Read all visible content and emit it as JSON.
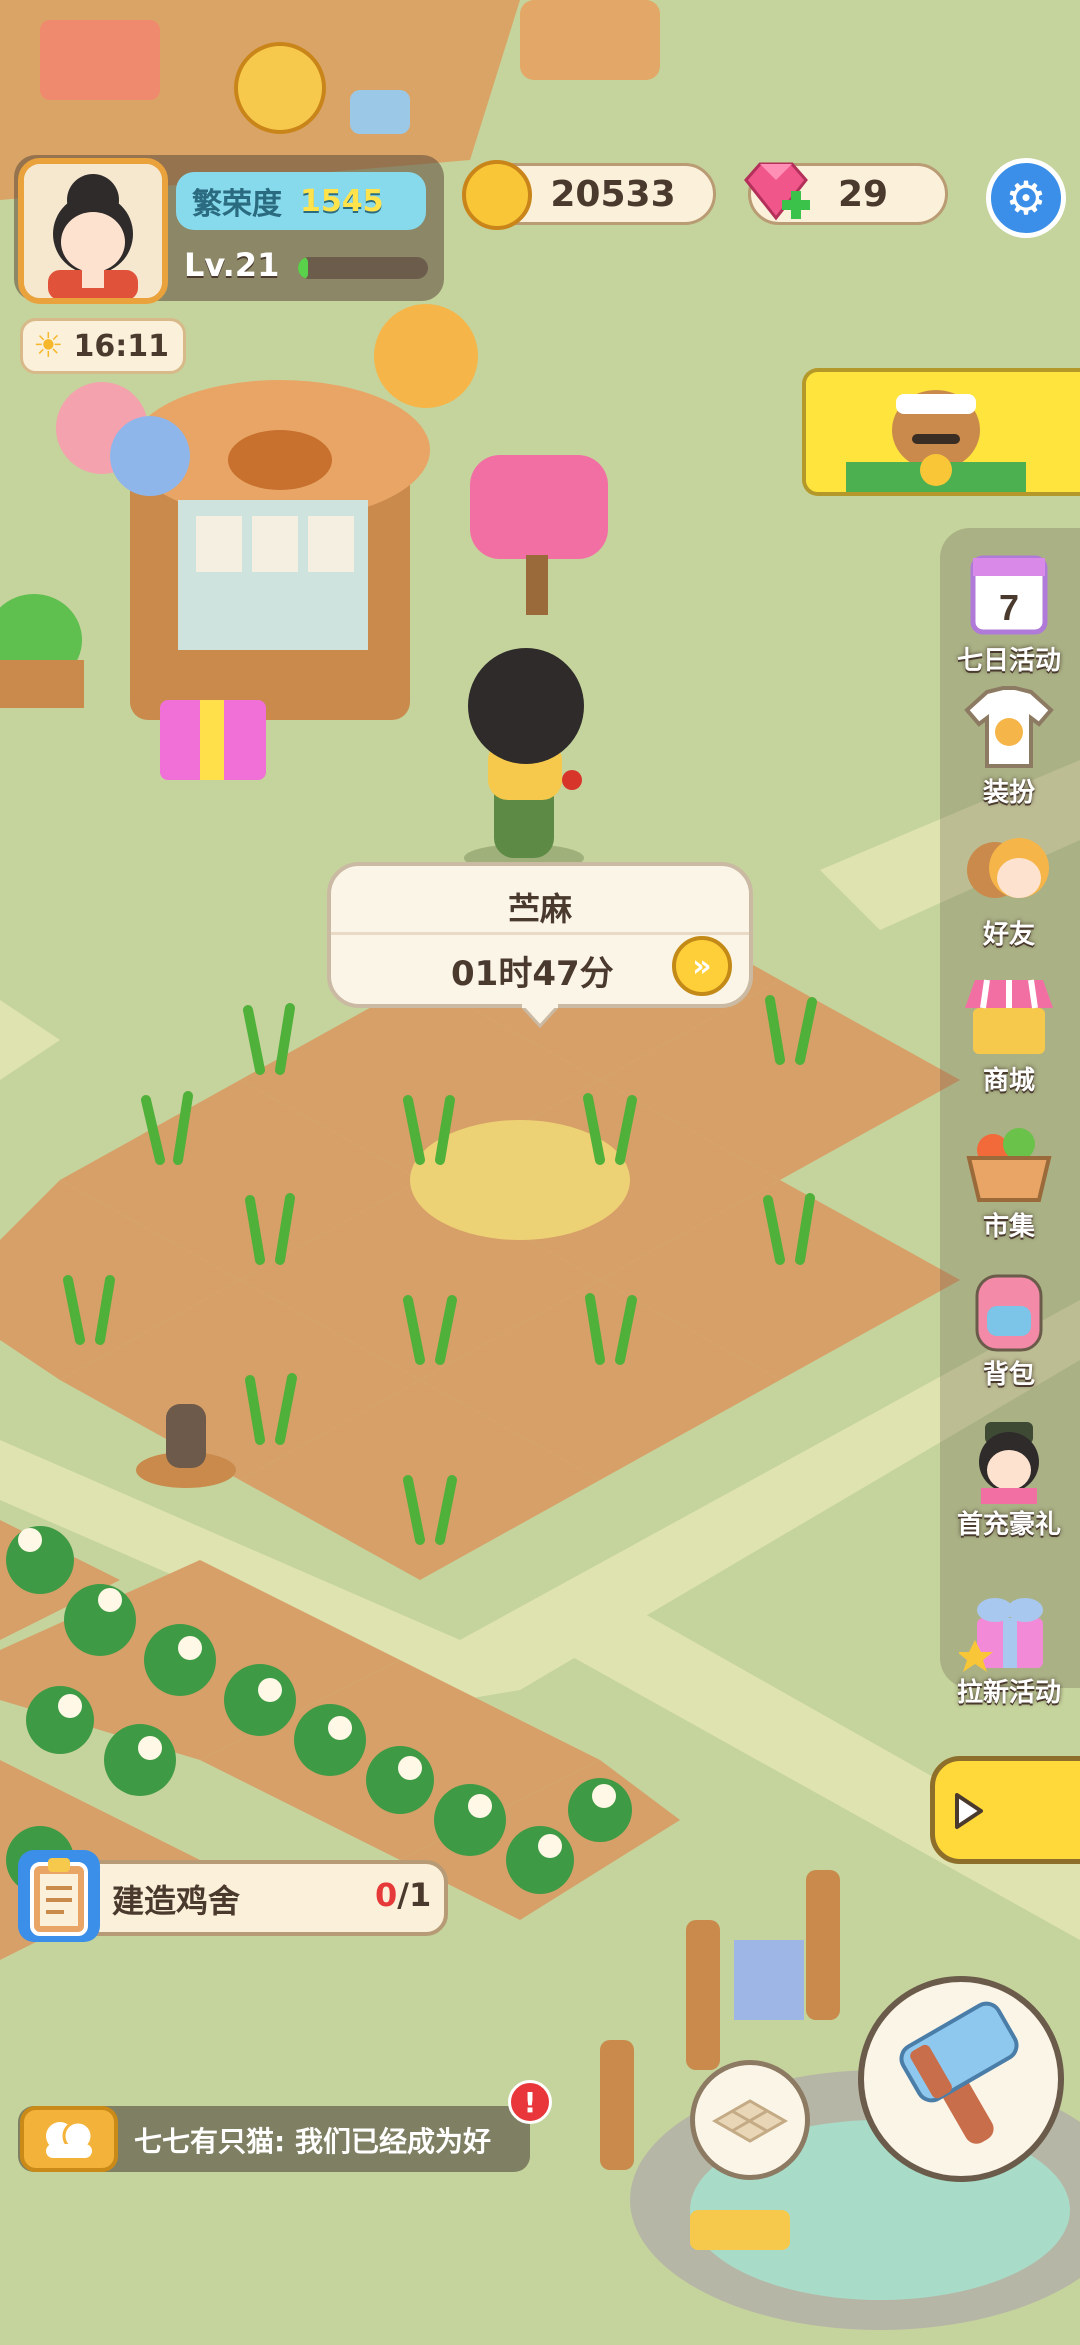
{
  "hud": {
    "prosperity_label": "繁荣度",
    "prosperity_value": "1545",
    "level": "Lv.21",
    "xp_progress": 0.08,
    "time": "16:11",
    "coins": "20533",
    "gems": "29"
  },
  "crop_tooltip": {
    "name": "苎麻",
    "remaining": "01时47分"
  },
  "side_menu": [
    {
      "label": "七日活动",
      "icon": "calendar-icon"
    },
    {
      "label": "装扮",
      "icon": "tshirt-icon"
    },
    {
      "label": "好友",
      "icon": "friends-icon"
    },
    {
      "label": "商城",
      "icon": "shop-icon"
    },
    {
      "label": "市集",
      "icon": "market-basket-icon"
    },
    {
      "label": "背包",
      "icon": "backpack-icon"
    },
    {
      "label": "首充豪礼",
      "icon": "first-recharge-icon"
    },
    {
      "label": "拉新活动",
      "icon": "gift-box-icon"
    }
  ],
  "quest": {
    "title": "建造鸡舍",
    "current": "0",
    "total": "/1"
  },
  "chat": {
    "message": "七七有只猫: 我们已经成为好"
  },
  "colors": {
    "grass": "#c5d39c",
    "path": "#dfe3b0",
    "soil": "#d8a46a",
    "accent_blue": "#3b8fe8",
    "accent_yellow": "#ffd93a"
  }
}
